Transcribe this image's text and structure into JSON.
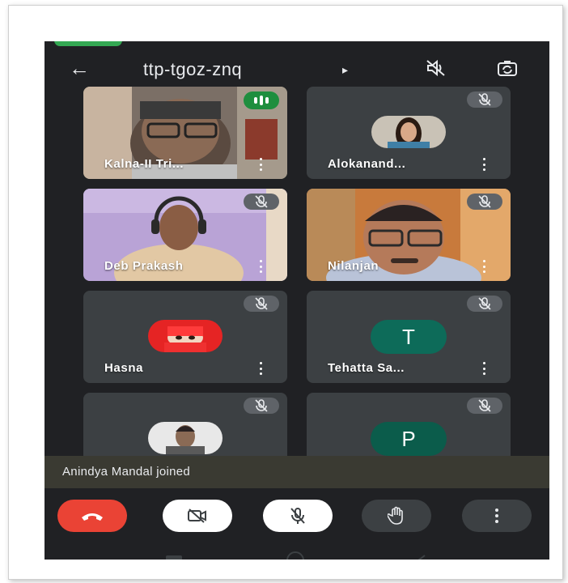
{
  "meeting": {
    "code": "ttp-tgoz-znq"
  },
  "icons": {
    "back": "arrow-left-icon",
    "title_caret": "caret-right-icon",
    "speaker_muted": "speaker-off-icon",
    "switch_camera": "switch-camera-icon",
    "mic_muted": "mic-off-icon",
    "speaking": "audio-level-icon",
    "more": "more-vertical-icon",
    "end_call": "phone-hangup-icon",
    "camera_off": "camera-off-icon",
    "raise_hand": "hand-icon"
  },
  "participants": [
    {
      "name": "Kalna-II Tri...",
      "type": "video",
      "speaking": true,
      "muted": false
    },
    {
      "name": "Alokanand...",
      "type": "photo",
      "speaking": false,
      "muted": true
    },
    {
      "name": "Deb Prakash",
      "type": "video",
      "speaking": false,
      "muted": true
    },
    {
      "name": "Nilanjan",
      "type": "video",
      "speaking": false,
      "muted": true
    },
    {
      "name": "Hasna",
      "type": "photo",
      "speaking": false,
      "muted": true
    },
    {
      "name": "Tehatta Sa...",
      "type": "letter",
      "letter": "T",
      "speaking": false,
      "muted": true
    },
    {
      "name": "",
      "type": "photo",
      "speaking": false,
      "muted": true
    },
    {
      "name": "",
      "type": "letter",
      "letter": "P",
      "speaking": false,
      "muted": true
    }
  ],
  "toast": {
    "message": "Anindya Mandal joined"
  },
  "colors": {
    "background": "#202124",
    "tile": "#3c4043",
    "end_call": "#ea4335",
    "active_speaker": "#1e8e3e",
    "letter_avatar": "#0d6b59"
  }
}
